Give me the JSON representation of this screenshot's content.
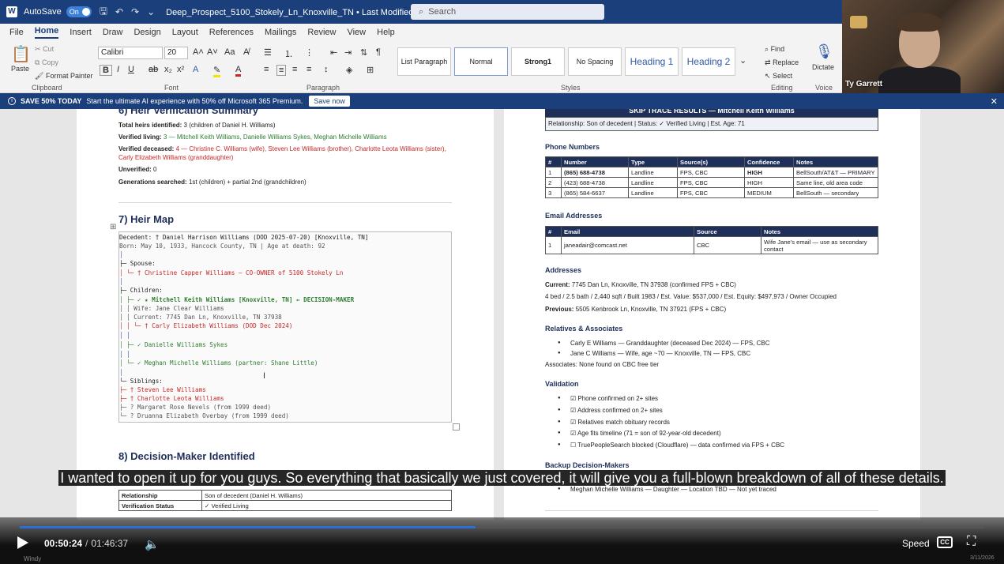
{
  "titlebar": {
    "autosave_label": "AutoSave",
    "autosave_state": "On",
    "doc_title": "Deep_Prospect_5100_Stokely_Ln_Knoxville_TN • Last Modified: 1h ago ⌄",
    "search_placeholder": "Search"
  },
  "menu": [
    "File",
    "Home",
    "Insert",
    "Draw",
    "Design",
    "Layout",
    "References",
    "Mailings",
    "Review",
    "View",
    "Help"
  ],
  "ribbon": {
    "paste": "Paste",
    "cut": "Cut",
    "copy": "Copy",
    "format_painter": "Format Painter",
    "clipboard": "Clipboard",
    "font_name": "Calibri",
    "font_size": "20",
    "font": "Font",
    "paragraph": "Paragraph",
    "styles_label": "Styles",
    "styles": [
      "List Paragraph",
      "Normal",
      "Strong1",
      "No Spacing",
      "Heading 1",
      "Heading 2"
    ],
    "find": "Find",
    "replace": "Replace",
    "select": "Select",
    "editing": "Editing",
    "dictate": "Dictate",
    "voice": "Voice"
  },
  "webcam": {
    "name": "Ty Garrett"
  },
  "promo": {
    "bold": "SAVE 50% TODAY",
    "message": "Start the ultimate AI experience with 50% off Microsoft 365 Premium.",
    "button": "Save now"
  },
  "left": {
    "sec6_title": "6) Heir Verification Summary",
    "total_heirs_label": "Total heirs identified:",
    "total_heirs_value": "3 (children of Daniel H. Williams)",
    "verified_living_label": "Verified living:",
    "verified_living_value": "3 — Mitchell Keith Williams, Danielle Williams Sykes, Meghan Michelle Williams",
    "verified_deceased_label": "Verified deceased:",
    "verified_deceased_value_1": "4 — Christine C. Williams (wife), Steven Lee Williams (brother), Charlotte Leota Williams (sister),",
    "verified_deceased_value_2": "Carly Elizabeth Williams (granddaughter)",
    "unverified_label": "Unverified:",
    "unverified_value": "0",
    "generations_label": "Generations searched:",
    "generations_value": "1st (children) + partial 2nd (grandchildren)",
    "sec7_title": "7) Heir Map",
    "heir_lines": [
      "Decedent: † Daniel Harrison Williams (DOD 2025-07-20) [Knoxville, TN]",
      "  Born: May 10, 1933, Hancock County, TN | Age at death: 92",
      "│",
      "├─ Spouse:",
      "│  └─ † Christine Capper Williams — CO-OWNER of 5100 Stokely Ln",
      "│",
      "├─ Children:",
      "│  ├─ ✓ ★ Mitchell Keith Williams [Knoxville, TN] ← DECISION-MAKER",
      "│  │     Wife: Jane Clear Williams",
      "│  │     Current: 7745 Dan Ln, Knoxville, TN 37938",
      "│  │  └─ † Carly Elizabeth Williams (DOD Dec 2024)",
      "│  │",
      "│  ├─ ✓ Danielle Williams Sykes",
      "│  │",
      "│  └─ ✓ Meghan Michelle Williams (partner: Shane Little)",
      "│",
      "└─ Siblings:",
      "   ├─ † Steven Lee Williams",
      "   ├─ † Charlotte Leota Williams",
      "   ├─ ? Margaret Rose Nevels (from 1999 deed)",
      "   └─ ? Druanna Elizabeth Overbay (from 1999 deed)"
    ],
    "sec8_title": "8) Decision-Maker Identified",
    "dm_rows": [
      [
        "Relationship",
        "Son of decedent (Daniel H. Williams)"
      ],
      [
        "Verification Status",
        "✓ Verified Living"
      ]
    ]
  },
  "right": {
    "skip_title": "SKIP TRACE RESULTS — Mitchell Keith Williams",
    "skip_sub": "Relationship: Son of decedent | Status: ✓ Verified Living | Est. Age: 71",
    "phone_title": "Phone Numbers",
    "phone_headers": [
      "#",
      "Number",
      "Type",
      "Source(s)",
      "Confidence",
      "Notes"
    ],
    "phone_rows": [
      [
        "1",
        "(865) 688-4738",
        "Landline",
        "FPS, CBC",
        "HIGH",
        "BellSouth/AT&T — PRIMARY"
      ],
      [
        "2",
        "(423) 688-4738",
        "Landline",
        "FPS, CBC",
        "HIGH",
        "Same line, old area code"
      ],
      [
        "3",
        "(865) 584-6637",
        "Landline",
        "FPS, CBC",
        "MEDIUM",
        "BellSouth — secondary"
      ]
    ],
    "email_title": "Email Addresses",
    "email_headers": [
      "#",
      "Email",
      "Source",
      "Notes"
    ],
    "email_rows": [
      [
        "1",
        "janeadair@comcast.net",
        "CBC",
        "Wife Jane's email — use as secondary contact"
      ]
    ],
    "addr_title": "Addresses",
    "addr_current_label": "Current:",
    "addr_current": "7745 Dan Ln, Knoxville, TN 37938 (confirmed FPS + CBC)",
    "addr_details": "4 bed / 2.5 bath / 2,440 sqft / Built 1983 / Est. Value: $537,000 / Est. Equity: $497,973 / Owner Occupied",
    "addr_prev_label": "Previous:",
    "addr_prev": "5505 Kenbrook Ln, Knoxville, TN 37921 (FPS + CBC)",
    "rel_title": "Relatives & Associates",
    "relatives": [
      "Carly E Williams — Granddaughter (deceased Dec 2024) — FPS, CBC",
      "Jane C Williams — Wife, age ~70 — Knoxville, TN — FPS, CBC"
    ],
    "associates": "Associates: None found on CBC free tier",
    "val_title": "Validation",
    "validation": [
      "☑ Phone confirmed on 2+ sites",
      "☑ Address confirmed on 2+ sites",
      "☑ Relatives match obituary records",
      "☑ Age fits timeline (71 = son of 92-year-old decedent)",
      "☐ TruePeopleSearch blocked (Cloudflare) — data confirmed via FPS + CBC"
    ],
    "backup_title": "Backup Decision-Makers",
    "backup": [
      "Meghan Michelle Williams — Daughter — Location TBD — Not yet traced"
    ]
  },
  "caption": "I wanted to open it up for you guys. So everything that basically we just covered, it will give you a full-blown breakdown of all of these details.",
  "player": {
    "current_time": "00:50:24",
    "duration": "01:46:37",
    "progress": 0.4725,
    "speed_label": "Speed",
    "cc_label": "CC",
    "windy": "Windy",
    "date": "3/11/2026"
  },
  "colors": {
    "accent": "#1b3f7a",
    "heading": "#1e2f5a",
    "living": "#2e7d32",
    "deceased": "#c62828",
    "progress": "#2b6fd6"
  }
}
